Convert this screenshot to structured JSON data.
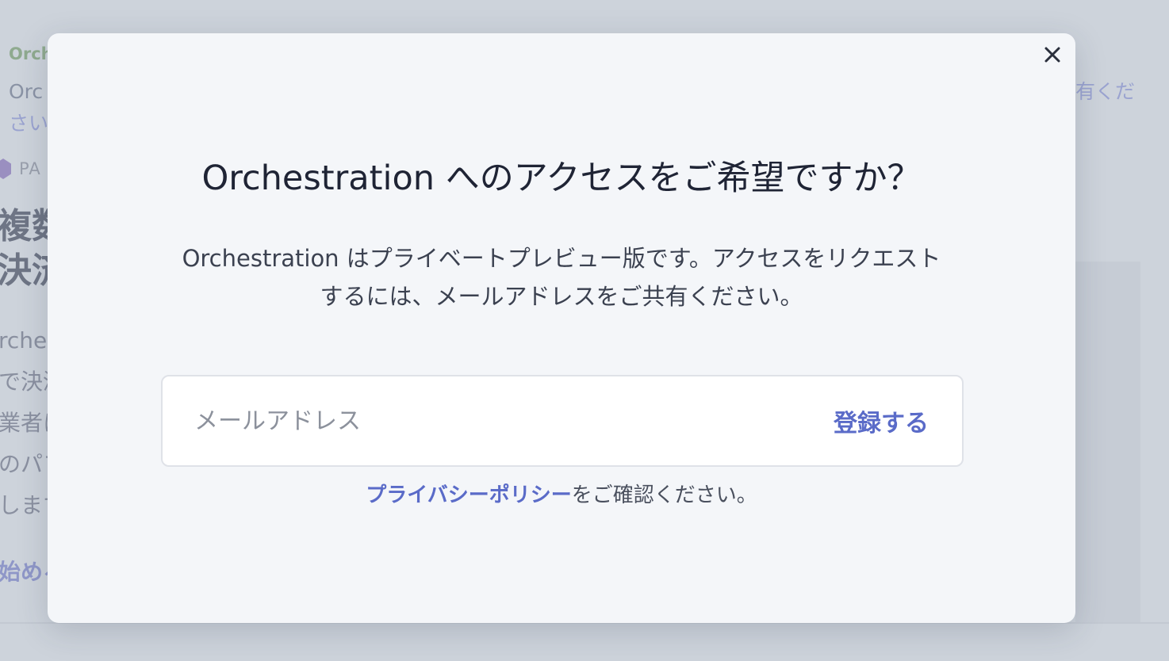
{
  "background": {
    "eyebrow": "Orch",
    "description_line1": "Orc",
    "description_line1_right": "有くだ",
    "description_line2": "さい",
    "badge_text": "PA",
    "heading_lines": [
      "複数",
      "決済"
    ],
    "body_lines": [
      "rche",
      "で決済",
      "業者に",
      "のパフ",
      "します"
    ],
    "cta": "始める"
  },
  "modal": {
    "title": "Orchestration へのアクセスをご希望ですか？",
    "description_line1": "Orchestration はプライベートプレビュー版です。アクセスをリクエスト",
    "description_line2": "するには、メールアドレスをご共有ください。",
    "email_placeholder": "メールアドレス",
    "submit_label": "登録する",
    "privacy_link": "プライバシーポリシー",
    "privacy_suffix": "をご確認ください。",
    "close_icon": "close-icon"
  },
  "colors": {
    "accent": "#5a6bc8",
    "title": "#1f2435",
    "modal_bg": "#f4f6f9",
    "overlay": "#cdd3db"
  }
}
